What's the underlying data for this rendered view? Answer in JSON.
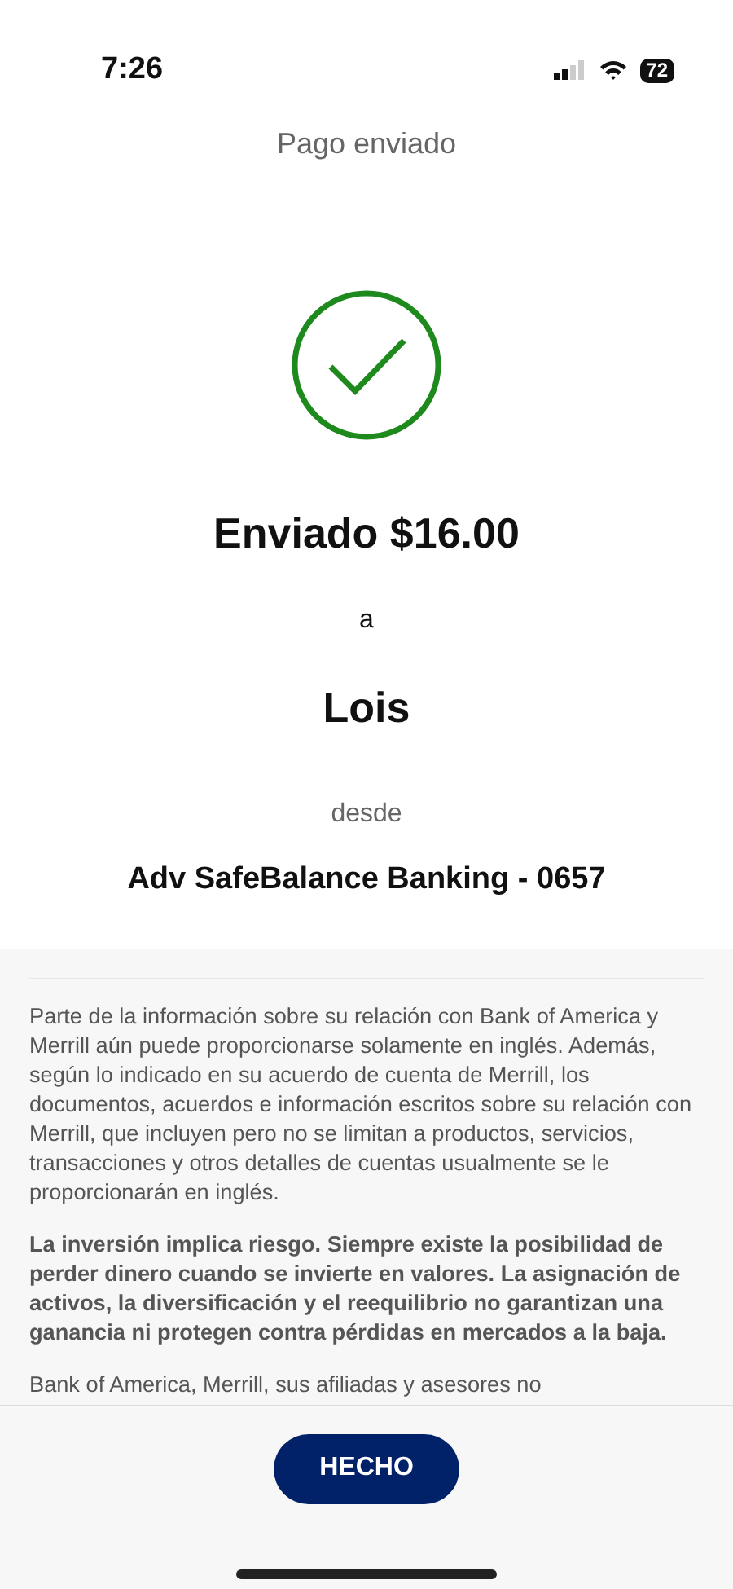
{
  "status_bar": {
    "time": "7:26",
    "battery": "72"
  },
  "header": {
    "title": "Pago enviado"
  },
  "confirmation": {
    "amount": "Enviado $16.00",
    "connector": "a",
    "recipient": "Lois",
    "from_label": "desde",
    "account": "Adv SafeBalance Banking - 0657"
  },
  "disclosures": [
    {
      "kind": "normal",
      "text": "Parte de la información sobre su relación con Bank of America y Merrill aún puede proporcionarse solamente en inglés. Además, según lo indicado en su acuerdo de cuenta de Merrill, los documentos, acuerdos e información escritos sobre su relación con Merrill, que incluyen pero no se limitan a productos, servicios, transacciones y otros detalles de cuentas usualmente se le proporcionarán en inglés."
    },
    {
      "kind": "bold",
      "text": "La inversión implica riesgo. Siempre existe la posibilidad de perder dinero cuando se invierte en valores. La asignación de activos, la diversificación y el reequilibrio no garantizan una ganancia ni protegen contra pérdidas en mercados a la baja."
    },
    {
      "kind": "normal",
      "text": "Bank of America, Merrill, sus afiliadas y asesores no"
    }
  ],
  "done_button": "HECHO"
}
